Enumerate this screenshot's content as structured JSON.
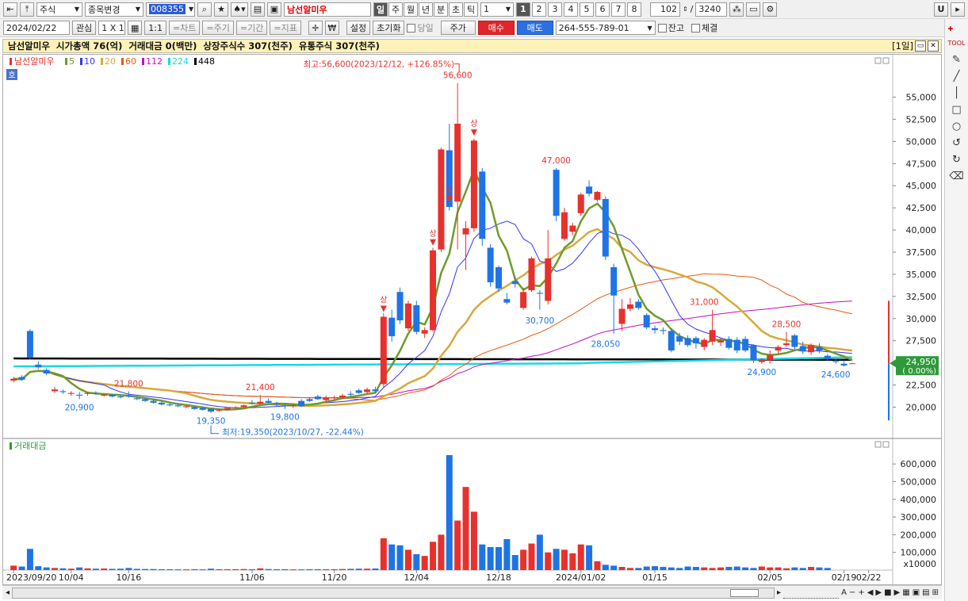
{
  "toolbar": {
    "market_type": "주식",
    "change_label": "종목변경",
    "code": "008355",
    "stock_name": "남선알미우",
    "periods": [
      "일",
      "주",
      "월",
      "년",
      "분",
      "초",
      "틱"
    ],
    "period_value": "1",
    "pages": [
      "1",
      "2",
      "3",
      "4",
      "5",
      "6",
      "7",
      "8"
    ],
    "active_page": "1",
    "count_value": "102",
    "total_value": "3240",
    "u_label": "U"
  },
  "toolbar2": {
    "date": "2024/02/22",
    "watch_label": "관심",
    "layout_label": "1 X 1",
    "one_to_one": "1:1",
    "chart_btn": "=차트",
    "period_btn": "=주기",
    "range_btn": "=기간",
    "indicator_btn": "=지표",
    "won_icon": "₩",
    "settings_label": "설정",
    "reset_label": "초기화",
    "same_day_label": "당일",
    "price_label": "주가",
    "buy_label": "매수",
    "sell_label": "매도",
    "account": "264-555-789-01",
    "balance_label": "잔고",
    "fill_label": "체결"
  },
  "header": {
    "text": "남선알미우  시가총액 76(억)  거래대금 0(백만)  상장주식수 307(천주)  유통주식 307(천주)",
    "right_label": "[1일]"
  },
  "legend": {
    "name": "남선알미우",
    "mas": [
      "5",
      "10",
      "20",
      "60",
      "112",
      "224",
      "448"
    ],
    "mode_icon": "호",
    "volume_label": "거래대금"
  },
  "colors": {
    "up": "#e8302c",
    "down": "#1e74e6",
    "ma5": "#6f9b2b",
    "ma10": "#3333ff",
    "ma20": "#d8a93a",
    "ma60": "#e85a10",
    "ma112": "#c010c0",
    "ma224": "#18d8e8",
    "ma448": "#000000"
  },
  "chart_data": {
    "type": "candlestick",
    "price_ylim": [
      17000,
      58000
    ],
    "price_ticks": [
      "55,000",
      "52,500",
      "50,000",
      "47,500",
      "45,000",
      "42,500",
      "40,000",
      "37,500",
      "35,000",
      "32,500",
      "30,000",
      "27,500",
      "25,000",
      "22,500",
      "20,000"
    ],
    "price_tick_values": [
      55000,
      52500,
      50000,
      47500,
      45000,
      42500,
      40000,
      37500,
      35000,
      32500,
      30000,
      27500,
      25000,
      22500,
      20000
    ],
    "volume_ylim": [
      0,
      650000
    ],
    "volume_ticks": [
      "600,000",
      "500,000",
      "400,000",
      "300,000",
      "200,000",
      "100,000"
    ],
    "volume_tick_values": [
      600000,
      500000,
      400000,
      300000,
      200000,
      100000
    ],
    "volume_unit": "x10000",
    "x_labels": [
      "2023/09/20",
      "10/04",
      "10/16",
      "11/06",
      "11/20",
      "12/04",
      "12/18",
      "2024/01/02",
      "01/15",
      "02/05",
      "02/19",
      "02/22"
    ],
    "x_label_candle_index": [
      0,
      7,
      14,
      29,
      39,
      49,
      59,
      69,
      78,
      92,
      101,
      104
    ],
    "current_price": "24,950",
    "current_change": "( 0.00%)",
    "high_annotation": "최고:56,600(2023/12/12, +126.85%)",
    "low_annotation": "최저:19,350(2023/10/27, -22.44%)",
    "upper_limit_label": "상",
    "price_labels": [
      {
        "text": "56,600",
        "i": 54,
        "v": 56600,
        "color": "up"
      },
      {
        "text": "47,000",
        "i": 66,
        "v": 47000,
        "color": "up"
      },
      {
        "text": "31,000",
        "i": 84,
        "v": 31000,
        "color": "up"
      },
      {
        "text": "28,500",
        "i": 94,
        "v": 28500,
        "color": "up"
      },
      {
        "text": "21,800",
        "i": 14,
        "v": 21800,
        "color": "up"
      },
      {
        "text": "21,400",
        "i": 30,
        "v": 21400,
        "color": "up"
      },
      {
        "text": "20,900",
        "i": 8,
        "v": 20900,
        "color": "down"
      },
      {
        "text": "19,350",
        "i": 24,
        "v": 19350,
        "color": "down"
      },
      {
        "text": "19,800",
        "i": 33,
        "v": 19800,
        "color": "down"
      },
      {
        "text": "30,700",
        "i": 64,
        "v": 30700,
        "color": "down"
      },
      {
        "text": "28,050",
        "i": 72,
        "v": 28050,
        "color": "down"
      },
      {
        "text": "24,900",
        "i": 91,
        "v": 24900,
        "color": "down"
      },
      {
        "text": "24,600",
        "i": 100,
        "v": 24600,
        "color": "down"
      }
    ],
    "limit_up_indices": [
      45,
      51,
      53,
      56
    ],
    "candles": [
      {
        "o": 23000,
        "h": 23400,
        "l": 22800,
        "c": 23200
      },
      {
        "o": 23400,
        "h": 23600,
        "l": 23000,
        "c": 23100
      },
      {
        "o": 28600,
        "h": 28800,
        "l": 25400,
        "c": 25600
      },
      {
        "o": 24800,
        "h": 25200,
        "l": 24300,
        "c": 24500
      },
      {
        "o": 24200,
        "h": 24400,
        "l": 23600,
        "c": 23800
      },
      {
        "o": 21800,
        "h": 22300,
        "l": 21600,
        "c": 22000
      },
      {
        "o": 21800,
        "h": 22000,
        "l": 21500,
        "c": 21700
      },
      {
        "o": 21500,
        "h": 21800,
        "l": 21300,
        "c": 21600
      },
      {
        "o": 21400,
        "h": 21700,
        "l": 20900,
        "c": 21300
      },
      {
        "o": 21500,
        "h": 21700,
        "l": 21300,
        "c": 21600
      },
      {
        "o": 21600,
        "h": 21800,
        "l": 21400,
        "c": 21500
      },
      {
        "o": 21300,
        "h": 21500,
        "l": 21200,
        "c": 21400
      },
      {
        "o": 21400,
        "h": 21500,
        "l": 21100,
        "c": 21200
      },
      {
        "o": 21200,
        "h": 21400,
        "l": 21000,
        "c": 21100
      },
      {
        "o": 21300,
        "h": 21800,
        "l": 21100,
        "c": 21200
      },
      {
        "o": 21000,
        "h": 21200,
        "l": 20800,
        "c": 20900
      },
      {
        "o": 20900,
        "h": 21000,
        "l": 20600,
        "c": 20700
      },
      {
        "o": 20700,
        "h": 20900,
        "l": 20400,
        "c": 20500
      },
      {
        "o": 20500,
        "h": 20700,
        "l": 20200,
        "c": 20300
      },
      {
        "o": 20300,
        "h": 20500,
        "l": 20100,
        "c": 20200
      },
      {
        "o": 20200,
        "h": 20400,
        "l": 20000,
        "c": 20100
      },
      {
        "o": 20000,
        "h": 20200,
        "l": 19900,
        "c": 20100
      },
      {
        "o": 20000,
        "h": 20100,
        "l": 19700,
        "c": 19800
      },
      {
        "o": 19900,
        "h": 20000,
        "l": 19600,
        "c": 19700
      },
      {
        "o": 19800,
        "h": 19900,
        "l": 19350,
        "c": 19500
      },
      {
        "o": 19600,
        "h": 19800,
        "l": 19500,
        "c": 19700
      },
      {
        "o": 19700,
        "h": 20000,
        "l": 19600,
        "c": 19900
      },
      {
        "o": 19900,
        "h": 20100,
        "l": 19800,
        "c": 20000
      },
      {
        "o": 20000,
        "h": 20300,
        "l": 19900,
        "c": 20200
      },
      {
        "o": 20500,
        "h": 20800,
        "l": 20300,
        "c": 20400
      },
      {
        "o": 20400,
        "h": 21400,
        "l": 20300,
        "c": 20600
      },
      {
        "o": 20700,
        "h": 21000,
        "l": 20400,
        "c": 20500
      },
      {
        "o": 20400,
        "h": 20600,
        "l": 20100,
        "c": 20300
      },
      {
        "o": 20200,
        "h": 20400,
        "l": 19800,
        "c": 20100
      },
      {
        "o": 20100,
        "h": 20300,
        "l": 19900,
        "c": 20200
      },
      {
        "o": 20700,
        "h": 20900,
        "l": 20000,
        "c": 20100
      },
      {
        "o": 20900,
        "h": 21100,
        "l": 20600,
        "c": 20700
      },
      {
        "o": 21200,
        "h": 21400,
        "l": 20800,
        "c": 20900
      },
      {
        "o": 20800,
        "h": 21300,
        "l": 20600,
        "c": 21100
      },
      {
        "o": 21000,
        "h": 21300,
        "l": 20800,
        "c": 21100
      },
      {
        "o": 21100,
        "h": 21500,
        "l": 20900,
        "c": 21300
      },
      {
        "o": 21500,
        "h": 21800,
        "l": 21200,
        "c": 21400
      },
      {
        "o": 21900,
        "h": 22100,
        "l": 21500,
        "c": 21600
      },
      {
        "o": 21700,
        "h": 22200,
        "l": 21500,
        "c": 22000
      },
      {
        "o": 22000,
        "h": 22300,
        "l": 21600,
        "c": 21800
      },
      {
        "o": 22600,
        "h": 30600,
        "l": 22200,
        "c": 30200
      },
      {
        "o": 30100,
        "h": 31000,
        "l": 27400,
        "c": 28000
      },
      {
        "o": 33000,
        "h": 33500,
        "l": 29400,
        "c": 29800
      },
      {
        "o": 28900,
        "h": 32000,
        "l": 28600,
        "c": 31700
      },
      {
        "o": 31500,
        "h": 32000,
        "l": 28200,
        "c": 28500
      },
      {
        "o": 28300,
        "h": 29000,
        "l": 27800,
        "c": 28700
      },
      {
        "o": 28700,
        "h": 38000,
        "l": 28500,
        "c": 37700
      },
      {
        "o": 37800,
        "h": 49300,
        "l": 37500,
        "c": 49100
      },
      {
        "o": 49000,
        "h": 52000,
        "l": 42200,
        "c": 42600
      },
      {
        "o": 43200,
        "h": 56600,
        "l": 37800,
        "c": 52000
      },
      {
        "o": 39500,
        "h": 41000,
        "l": 35500,
        "c": 40200
      },
      {
        "o": 40200,
        "h": 50300,
        "l": 39800,
        "c": 50100
      },
      {
        "o": 46600,
        "h": 47000,
        "l": 38200,
        "c": 39000
      },
      {
        "o": 38000,
        "h": 38400,
        "l": 33600,
        "c": 34100
      },
      {
        "o": 35800,
        "h": 36000,
        "l": 33000,
        "c": 33400
      },
      {
        "o": 32200,
        "h": 32900,
        "l": 31600,
        "c": 31800
      },
      {
        "o": 34200,
        "h": 34700,
        "l": 33500,
        "c": 33900
      },
      {
        "o": 31200,
        "h": 33500,
        "l": 31000,
        "c": 33000
      },
      {
        "o": 33200,
        "h": 37000,
        "l": 33000,
        "c": 36800
      },
      {
        "o": 32900,
        "h": 33200,
        "l": 31000,
        "c": 32800
      },
      {
        "o": 32000,
        "h": 40000,
        "l": 31600,
        "c": 36800
      },
      {
        "o": 46800,
        "h": 47000,
        "l": 41000,
        "c": 41600
      },
      {
        "o": 39000,
        "h": 42500,
        "l": 38800,
        "c": 42000
      },
      {
        "o": 39800,
        "h": 40800,
        "l": 39400,
        "c": 40500
      },
      {
        "o": 41900,
        "h": 44200,
        "l": 41600,
        "c": 44000
      },
      {
        "o": 44900,
        "h": 45600,
        "l": 43800,
        "c": 44100
      },
      {
        "o": 43400,
        "h": 44400,
        "l": 43200,
        "c": 44300
      },
      {
        "o": 43500,
        "h": 43800,
        "l": 36600,
        "c": 37000
      },
      {
        "o": 35800,
        "h": 36200,
        "l": 28300,
        "c": 32600
      },
      {
        "o": 29400,
        "h": 32200,
        "l": 28600,
        "c": 31100
      },
      {
        "o": 31100,
        "h": 32300,
        "l": 30800,
        "c": 31600
      },
      {
        "o": 31900,
        "h": 32200,
        "l": 31000,
        "c": 31200
      },
      {
        "o": 30400,
        "h": 30600,
        "l": 28800,
        "c": 29000
      },
      {
        "o": 28900,
        "h": 29200,
        "l": 28300,
        "c": 28700
      },
      {
        "o": 28700,
        "h": 29000,
        "l": 28200,
        "c": 28600
      },
      {
        "o": 28600,
        "h": 28900,
        "l": 26200,
        "c": 26400
      },
      {
        "o": 28000,
        "h": 28400,
        "l": 27000,
        "c": 27400
      },
      {
        "o": 27800,
        "h": 28100,
        "l": 26800,
        "c": 27000
      },
      {
        "o": 27800,
        "h": 28000,
        "l": 26600,
        "c": 27200
      },
      {
        "o": 26800,
        "h": 27800,
        "l": 26400,
        "c": 27600
      },
      {
        "o": 27400,
        "h": 31000,
        "l": 27000,
        "c": 28700
      },
      {
        "o": 27300,
        "h": 27800,
        "l": 26900,
        "c": 27500
      },
      {
        "o": 27700,
        "h": 28000,
        "l": 26500,
        "c": 26700
      },
      {
        "o": 27600,
        "h": 27900,
        "l": 26100,
        "c": 26400
      },
      {
        "o": 27700,
        "h": 28000,
        "l": 26200,
        "c": 26400
      },
      {
        "o": 27000,
        "h": 27100,
        "l": 25000,
        "c": 25300
      },
      {
        "o": 25100,
        "h": 25500,
        "l": 24900,
        "c": 25400
      },
      {
        "o": 25300,
        "h": 26400,
        "l": 24900,
        "c": 25900
      },
      {
        "o": 26400,
        "h": 27000,
        "l": 26000,
        "c": 26800
      },
      {
        "o": 27000,
        "h": 28500,
        "l": 26800,
        "c": 27200
      },
      {
        "o": 28100,
        "h": 28300,
        "l": 26400,
        "c": 26800
      },
      {
        "o": 26900,
        "h": 27400,
        "l": 26000,
        "c": 26300
      },
      {
        "o": 26200,
        "h": 27200,
        "l": 25900,
        "c": 27000
      },
      {
        "o": 26800,
        "h": 27200,
        "l": 26100,
        "c": 26400
      },
      {
        "o": 25800,
        "h": 26000,
        "l": 25200,
        "c": 25400
      },
      {
        "o": 25200,
        "h": 25500,
        "l": 24900,
        "c": 25100
      },
      {
        "o": 24900,
        "h": 25200,
        "l": 24600,
        "c": 24700
      },
      {
        "o": 24950,
        "h": 25000,
        "l": 24900,
        "c": 24950
      }
    ],
    "volumes": [
      25000,
      20000,
      120000,
      22000,
      15000,
      12000,
      10000,
      8000,
      15000,
      10000,
      8000,
      9000,
      7000,
      8000,
      12000,
      7000,
      6000,
      6000,
      5000,
      5000,
      4000,
      4000,
      5000,
      4000,
      8000,
      5000,
      5000,
      5000,
      6000,
      5000,
      10000,
      6000,
      5000,
      5000,
      4000,
      4000,
      5000,
      5000,
      5000,
      5000,
      6000,
      7000,
      8000,
      8000,
      9000,
      180000,
      145000,
      140000,
      115000,
      90000,
      80000,
      160000,
      200000,
      650000,
      280000,
      470000,
      330000,
      145000,
      130000,
      130000,
      175000,
      85000,
      115000,
      150000,
      200000,
      100000,
      120000,
      115000,
      95000,
      145000,
      140000,
      50000,
      30000,
      25000,
      18000,
      12000,
      12000,
      20000,
      22000,
      18000,
      15000,
      12000,
      20000,
      18000,
      15000,
      12000,
      15000,
      18000,
      20000,
      15000,
      12000,
      20000,
      15000,
      15000,
      10000,
      15000,
      12000,
      18000,
      15000,
      12000
    ]
  }
}
